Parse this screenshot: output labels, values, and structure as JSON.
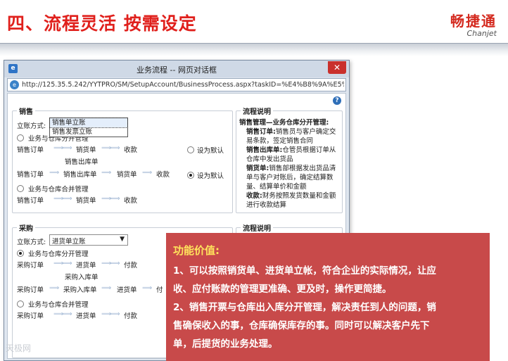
{
  "slide": {
    "title": "四、流程灵活 按需设定",
    "logo_cn": "畅捷通",
    "logo_en": "Chanjet"
  },
  "dialog": {
    "title": "业务流程 -- 网页对话框",
    "close": "✕",
    "url": "http://125.35.5.242/YYTPRO/SM/SetupAccount/BusinessProcess.aspx?taskID=%E4%B8%9A%E5%8A%A1%",
    "help": "?"
  },
  "sales": {
    "legend": "销售",
    "account_mode_label": "立账方式:",
    "dropdown_options": [
      "销售单立账",
      "销售发票立账"
    ],
    "option1_label": "业务与仓库分开管理",
    "row1": [
      "销售订单",
      "销货单",
      "收款"
    ],
    "row1_extra": "销售出库单",
    "row2": [
      "销售订单",
      "销售出库单",
      "销货单",
      "收款"
    ],
    "set_default_1": "设为默认",
    "set_default_2": "设为默认",
    "option2_label": "业务与仓库合并管理",
    "row3": [
      "销售订单",
      "销货单",
      "收款"
    ]
  },
  "sales_desc": {
    "legend": "流程说明",
    "heading": "销售管理—业务仓库分开管理:",
    "lines": [
      {
        "bold": "销售订单:",
        "text": "销售员与客户确定交易条款，签定销售合同"
      },
      {
        "bold": "销售出库单:",
        "text": "仓管员根据订单从仓库中发出货品"
      },
      {
        "bold": "销货单:",
        "text": "销售部根据发出货品清单与客户对账后，确定结算数量、结算单价和金额"
      },
      {
        "bold": "收款:",
        "text": "财务按照发货数量和金额进行收款结算"
      }
    ]
  },
  "purchase": {
    "legend": "采购",
    "account_mode_label": "立账方式:",
    "select_value": "进货单立账",
    "option1_label": "业务与仓库分开管理",
    "row1": [
      "采购订单",
      "进货单",
      "付款"
    ],
    "row1_extra": "采购入库单",
    "row2": [
      "采购订单",
      "采购入库单",
      "进货单",
      "付"
    ],
    "option2_label": "业务与仓库合并管理",
    "row3": [
      "采购订单",
      "进货单",
      "付款"
    ]
  },
  "purchase_desc": {
    "legend": "流程说明"
  },
  "value_box": {
    "title": "功能价值:",
    "lines": [
      "1、可以按照销货单、进货单立帐，符合企业的实际情况，让应",
      "收、应付账款的管理更准确、更及时，操作更简捷。",
      "2、销售开票与仓库出入库分开管理，解决责任到人的问题，销",
      "售确保收入的事，仓库确保库存的事。同时可以解决客户先下",
      "单，后提货的业务处理。"
    ]
  },
  "watermark": "天极网",
  "colors": {
    "title_red": "#e0201c",
    "value_box_bg": "#c84a4a",
    "value_title": "#ffe45c",
    "arrow": "#9fb6d3"
  }
}
